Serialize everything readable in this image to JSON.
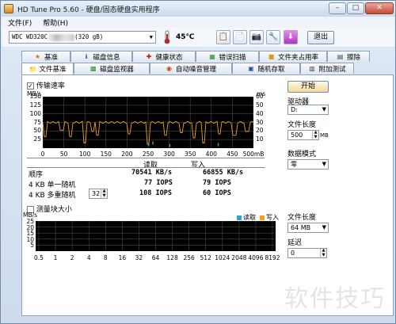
{
  "window": {
    "title": "HD Tune Pro 5.60 - 硬盘/固态硬盘实用程序"
  },
  "menu": [
    "文件(F)",
    "帮助(H)"
  ],
  "toolbar": {
    "drive_prefix": "WDC WD320C",
    "drive_suffix": "(320 gB)",
    "temperature": "45℃",
    "exit_label": "退出"
  },
  "tabs_row1": [
    "基准",
    "磁盘信息",
    "健康状态",
    "错误扫描",
    "文件夹占用率",
    "擦除"
  ],
  "tabs_row2": [
    "文件基准",
    "磁盘监视器",
    "自动噪音管理",
    "随机存取",
    "附加测试"
  ],
  "top_chart": {
    "checkbox_label": "传输速率",
    "left_unit": "MB/s",
    "right_unit": "ms",
    "left_ticks": [
      "150",
      "125",
      "100",
      "75",
      "50",
      "25"
    ],
    "right_ticks": [
      "60",
      "50",
      "40",
      "30",
      "20",
      "10"
    ],
    "x_ticks": [
      "0",
      "50",
      "100",
      "150",
      "200",
      "250",
      "300",
      "350",
      "400",
      "450",
      "500mB"
    ]
  },
  "results": {
    "col_read": "读取",
    "col_write": "写入",
    "rows": [
      {
        "label": "顺序",
        "read": "70541 KB/s",
        "write": "66855 KB/s"
      },
      {
        "label": "4 KB 单一随机",
        "read": "77 IOPS",
        "write": "79 IOPS"
      },
      {
        "label": "4 KB 多重随机",
        "queue": "32",
        "read": "108 IOPS",
        "write": "60 IOPS"
      }
    ]
  },
  "right_panel": {
    "start_label": "开始",
    "drive_label": "驱动器",
    "drive_value": "D:",
    "file_len_label": "文件长度",
    "file_len_value": "500",
    "file_len_unit": "MB",
    "data_mode_label": "数据模式",
    "data_mode_value": "零"
  },
  "block_chart": {
    "checkbox_label": "测量块大小",
    "unit": "MB/s",
    "y_ticks": [
      "25",
      "20",
      "15",
      "10",
      "5"
    ],
    "x_ticks": [
      "0.5",
      "1",
      "2",
      "4",
      "8",
      "16",
      "32",
      "64",
      "128",
      "256",
      "512",
      "1024",
      "2048",
      "4096",
      "8192"
    ],
    "legend_read": "读取",
    "legend_write": "写入",
    "legend_read_color": "#2aa7c9",
    "legend_write_color": "#f0a020"
  },
  "block_right": {
    "file_len_label": "文件长度",
    "file_len_value": "64 MB",
    "delay_label": "延迟",
    "delay_value": "0"
  },
  "watermark": "软件技巧",
  "colors": {
    "chart_bg": "#000000",
    "grid": "#4a4a4a",
    "read_line": "#f0a020",
    "access_points": "#2aa7c9"
  }
}
